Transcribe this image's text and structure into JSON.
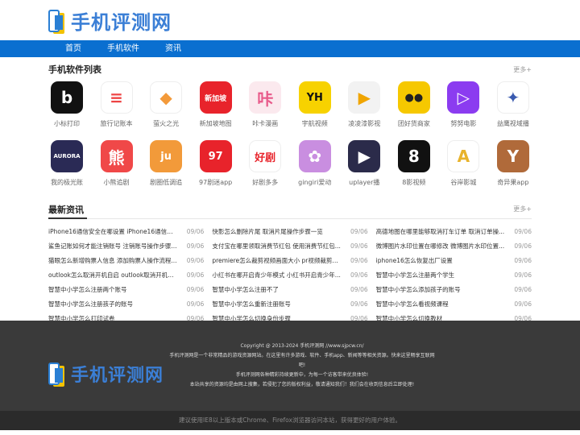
{
  "logo": {
    "text": "手机评测网"
  },
  "nav": [
    "首页",
    "手机软件",
    "资讯"
  ],
  "apps_section": {
    "title": "手机软件列表",
    "more": "更多+",
    "row1": [
      {
        "name": "小标打印",
        "bg": "#111111",
        "glyph": "b",
        "fg": "#ffffff"
      },
      {
        "name": "旅行记账本",
        "bg": "#ffffff",
        "glyph": "≡",
        "fg": "#e44"
      },
      {
        "name": "萤火之光",
        "bg": "#ffffff",
        "glyph": "◆",
        "fg": "#f39a3a"
      },
      {
        "name": "新加坡地图",
        "bg": "#e8232b",
        "glyph": "新加坡",
        "fg": "#ffffff"
      },
      {
        "name": "咔卡漫画",
        "bg": "#fbe9ee",
        "glyph": "咔",
        "fg": "#e85a8a"
      },
      {
        "name": "宇航视频",
        "bg": "#f7d200",
        "glyph": "YH",
        "fg": "#111"
      },
      {
        "name": "凌凌漆影视",
        "bg": "#f2f2f2",
        "glyph": "▶",
        "fg": "#f0a500"
      },
      {
        "name": "团好货商家",
        "bg": "#f6c800",
        "glyph": "●●",
        "fg": "#222"
      },
      {
        "name": "努努电影",
        "bg": "#8b3cf0",
        "glyph": "▷",
        "fg": "#ffffff"
      },
      {
        "name": "益鹰视域播",
        "bg": "#ffffff",
        "glyph": "✦",
        "fg": "#3a5bb0"
      }
    ],
    "row2": [
      {
        "name": "我的极光账",
        "bg": "#2a2a55",
        "glyph": "AURORA",
        "fg": "#ffffff"
      },
      {
        "name": "小熊追剧",
        "bg": "#f04848",
        "glyph": "熊",
        "fg": "#ffffff"
      },
      {
        "name": "剧圈低调追",
        "bg": "#f29a3a",
        "glyph": "ju",
        "fg": "#ffffff"
      },
      {
        "name": "97剧迷app",
        "bg": "#e8232b",
        "glyph": "97",
        "fg": "#ffffff"
      },
      {
        "name": "好剧多多",
        "bg": "#ffffff",
        "glyph": "好剧",
        "fg": "#e8232b"
      },
      {
        "name": "gingiri爱动",
        "bg": "#c98ee0",
        "glyph": "✿",
        "fg": "#ffffff"
      },
      {
        "name": "uplayer播",
        "bg": "#2b2b4a",
        "glyph": "▶",
        "fg": "#ffffff"
      },
      {
        "name": "8影视频",
        "bg": "#111111",
        "glyph": "8",
        "fg": "#ffffff"
      },
      {
        "name": "谷岸影城",
        "bg": "#ffffff",
        "glyph": "A",
        "fg": "#e8b32b"
      },
      {
        "name": "奇异果app",
        "bg": "#b06a3a",
        "glyph": "Y",
        "fg": "#ffffff"
      }
    ]
  },
  "news_section": {
    "title": "最新资讯",
    "more": "更多+",
    "items": [
      {
        "title": "iPhone16通信安全在哪设置 iPhone16通信安全...",
        "date": "09/06"
      },
      {
        "title": "快影怎么删除片尾 取消片尾操作步骤一览",
        "date": "09/06"
      },
      {
        "title": "高德地图在哪里能够取消打车订单 取消订单操...",
        "date": "09/06"
      },
      {
        "title": "鲨鱼记账如何才能注销账号 注销账号操作步骤...",
        "date": "09/06"
      },
      {
        "title": "支付宝在哪里领取消费节红包 使用消费节红包...",
        "date": "09/06"
      },
      {
        "title": "微博图片水印位置在哪修改 微博图片水印位置...",
        "date": "09/06"
      },
      {
        "title": "猫眼怎么新增购票人信息 添加购票人操作流程...",
        "date": "09/06"
      },
      {
        "title": "premiere怎么裁剪视频画面大小 pr视频裁剪画...",
        "date": "09/06"
      },
      {
        "title": "iphone16怎么恢复出厂设置",
        "date": "09/06"
      },
      {
        "title": "outlook怎么取消开机自启 outlook取消开机自启...",
        "date": "09/06"
      },
      {
        "title": "小红书在哪开启青少年模式 小红书开启青少年...",
        "date": "09/06"
      },
      {
        "title": "智慧中小学怎么注册两个学生",
        "date": "09/06"
      },
      {
        "title": "智慧中小学怎么注册两个账号",
        "date": "09/06"
      },
      {
        "title": "智慧中小学怎么注册不了",
        "date": "09/06"
      },
      {
        "title": "智慧中小学怎么添加孩子的账号",
        "date": "09/06"
      },
      {
        "title": "智慧中小学怎么注册孩子的账号",
        "date": "09/06"
      },
      {
        "title": "智慧中小学怎么重新注册账号",
        "date": "09/06"
      },
      {
        "title": "智慧中小学怎么看视频课程",
        "date": "09/06"
      },
      {
        "title": "智慧中小学怎么打印试卷",
        "date": "09/06"
      },
      {
        "title": "智慧中小学怎么切换身份步骤",
        "date": "09/06"
      },
      {
        "title": "智慧中小学怎么切换教材",
        "date": "09/06"
      }
    ]
  },
  "footer": {
    "copyright": "Copyright @ 2013-2024 手机评测网 //www.sjpcw.cn/",
    "line2": "手机评测网是一个非常精品的游戏资源网站。在这里有许多游戏、软件、手机app、新闻等等相关资源。快来这里畅享互联网吧!",
    "line3": "手机评测网各种精彩持续更新中，为每一个访客带来优良体验!",
    "line4": "本站共享的资源均是由网上搜集，若侵犯了您的版权利益，敬请通知我们！我们会在收到信息后立即处理!",
    "bottom": "建议使用IE8以上版本或Chrome、Firefox浏览器访问本站，获得更好的用户体验。"
  }
}
